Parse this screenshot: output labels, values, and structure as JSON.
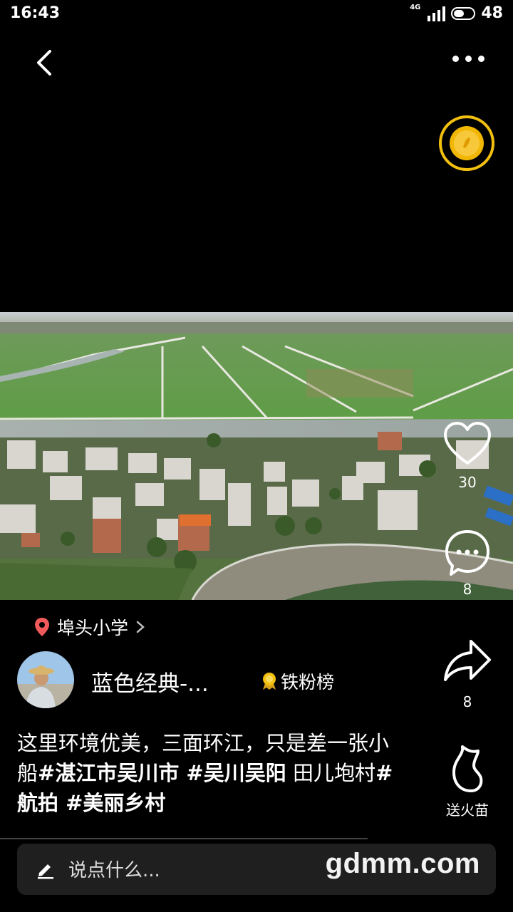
{
  "status_bar": {
    "time": "16:43",
    "network": "4G",
    "battery": "48"
  },
  "actions": {
    "likes": "30",
    "comments": "8",
    "shares": "8",
    "gift_label": "送火苗"
  },
  "post": {
    "location": "埠头小学",
    "username": "蓝色经典-...",
    "badge": "铁粉榜",
    "caption_plain_1": "这里环境优美，三面环江，只是差一张小船",
    "caption_tag_1": "#湛江市吴川市",
    "caption_tag_2": " #吴川吴阳",
    "caption_plain_2": " 田儿垉村",
    "caption_tag_3": "#航拍",
    "caption_tag_4": " #美丽乡村"
  },
  "comment_box": {
    "placeholder": "说点什么..."
  },
  "watermark": "gdmm.com",
  "colors": {
    "background": "#000000",
    "accent_gold": "#f2c00f",
    "location_pin": "#f05a5a"
  }
}
